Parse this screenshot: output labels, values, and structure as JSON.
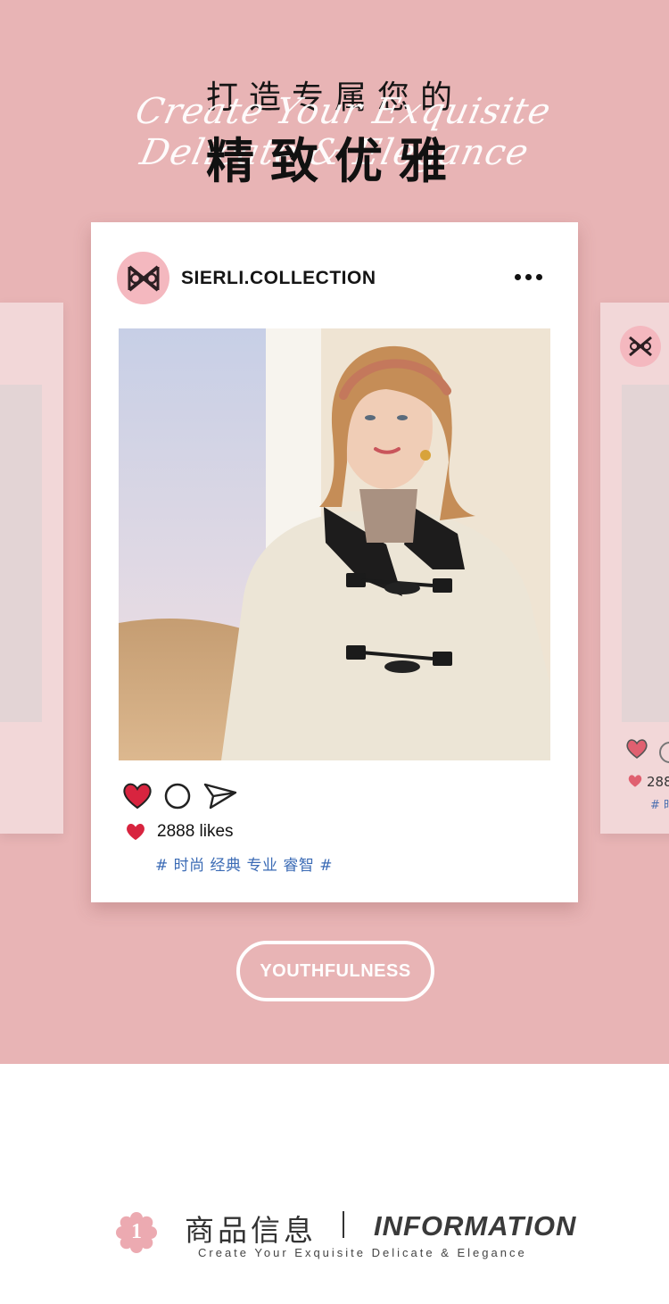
{
  "header": {
    "title_small": "打造专属您的",
    "script_line": "Create Your Exquisite Delicate & Elegance",
    "title_big": "精致优雅"
  },
  "post": {
    "account_name": "SIERLI.COLLECTION",
    "more_icon": "more-dots-icon",
    "likes": "2888 likes",
    "tags": "# 时尚 经典 专业 睿智 #",
    "icons": [
      "heart-icon",
      "comment-icon",
      "share-icon"
    ]
  },
  "side_card": {
    "likes": "288",
    "tag": "# 时"
  },
  "pill_button": "YOUTHFULNESS",
  "info": {
    "number": "1",
    "title_cn": "商品信息",
    "title_en": "INFORMATION",
    "subtitle": "Create Your Exquisite Delicate & Elegance"
  },
  "colors": {
    "background_pink": "#e8b4b5",
    "heart_red": "#d8243f",
    "tag_blue": "#3b6bb5",
    "avatar_pink": "#f4b8bf"
  }
}
